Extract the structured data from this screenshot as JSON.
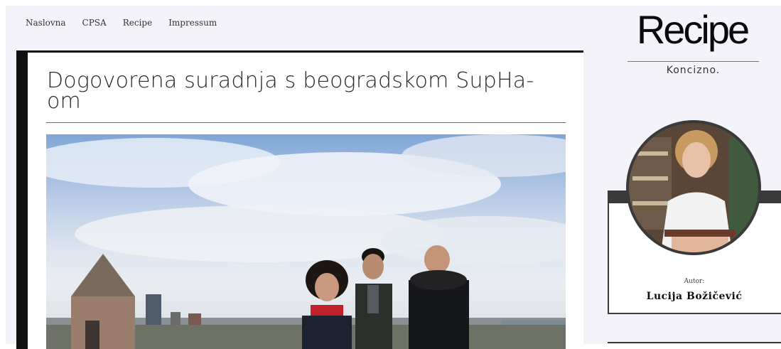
{
  "nav": {
    "items": [
      {
        "label": "Naslovna"
      },
      {
        "label": "CPSA"
      },
      {
        "label": "Recipe"
      },
      {
        "label": "Impressum"
      }
    ]
  },
  "article": {
    "title": "Dogovorena suradnja s beogradskom SupHa-om"
  },
  "sidebar": {
    "logo": "Recipe",
    "tagline": "Koncizno.",
    "author_label": "Autor:",
    "author_name": "Lucija Božičević"
  }
}
